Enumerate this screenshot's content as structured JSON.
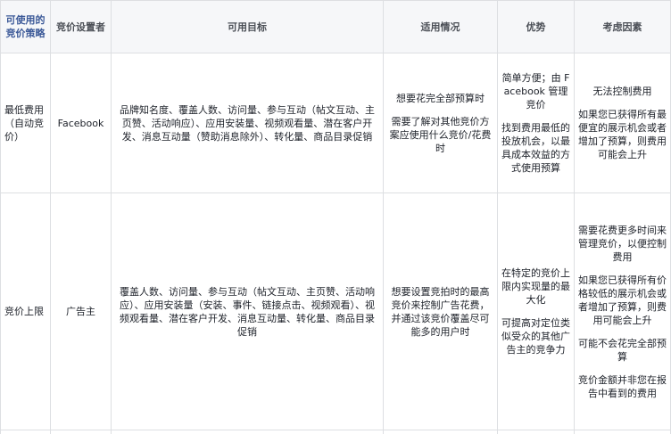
{
  "headers": [
    "可使用的竞价策略",
    "竞价设置者",
    "可用目标",
    "适用情况",
    "优势",
    "考虑因素"
  ],
  "rows": [
    {
      "strategy": "最低费用（自动竞价）",
      "setter": "Facebook",
      "goals": "品牌知名度、覆盖人数、访问量、参与互动（帖文互动、主页赞、活动响应）、应用安装量、视频观看量、潜在客户开发、消息互动量（赞助消息除外）、转化量、商品目录促销",
      "situations": [
        "想要花完全部预算时",
        "需要了解对其他竞价方案应使用什么竞价/花费时"
      ],
      "advantages": [
        "简单方便；由 Facebook 管理竞价",
        "找到费用最低的投放机会，以最具成本效益的方式使用预算"
      ],
      "considerations": [
        "无法控制费用",
        "如果您已获得所有最便宜的展示机会或者增加了预算，则费用可能会上升"
      ]
    },
    {
      "strategy": "竞价上限",
      "setter": "广告主",
      "goals": "覆盖人数、访问量、参与互动（帖文互动、主页赞、活动响应）、应用安装量（安装、事件、链接点击、视频观看）、视频观看量、潜在客户开发、消息互动量、转化量、商品目录促销",
      "situations": [
        "想要设置竞拍时的最高竞价来控制广告花费，并通过该竞价覆盖尽可能多的用户时"
      ],
      "advantages": [
        "在特定的竞价上限内实现量的最大化",
        "可提高对定位类似受众的其他广告主的竞争力"
      ],
      "considerations": [
        "需要花费更多时间来管理竞价，以便控制费用",
        "如果您已获得所有价格较低的展示机会或者增加了预算，则费用可能会上升",
        "可能不会花完全部预算",
        "竞价金额并非您在报告中看到的费用"
      ]
    }
  ]
}
